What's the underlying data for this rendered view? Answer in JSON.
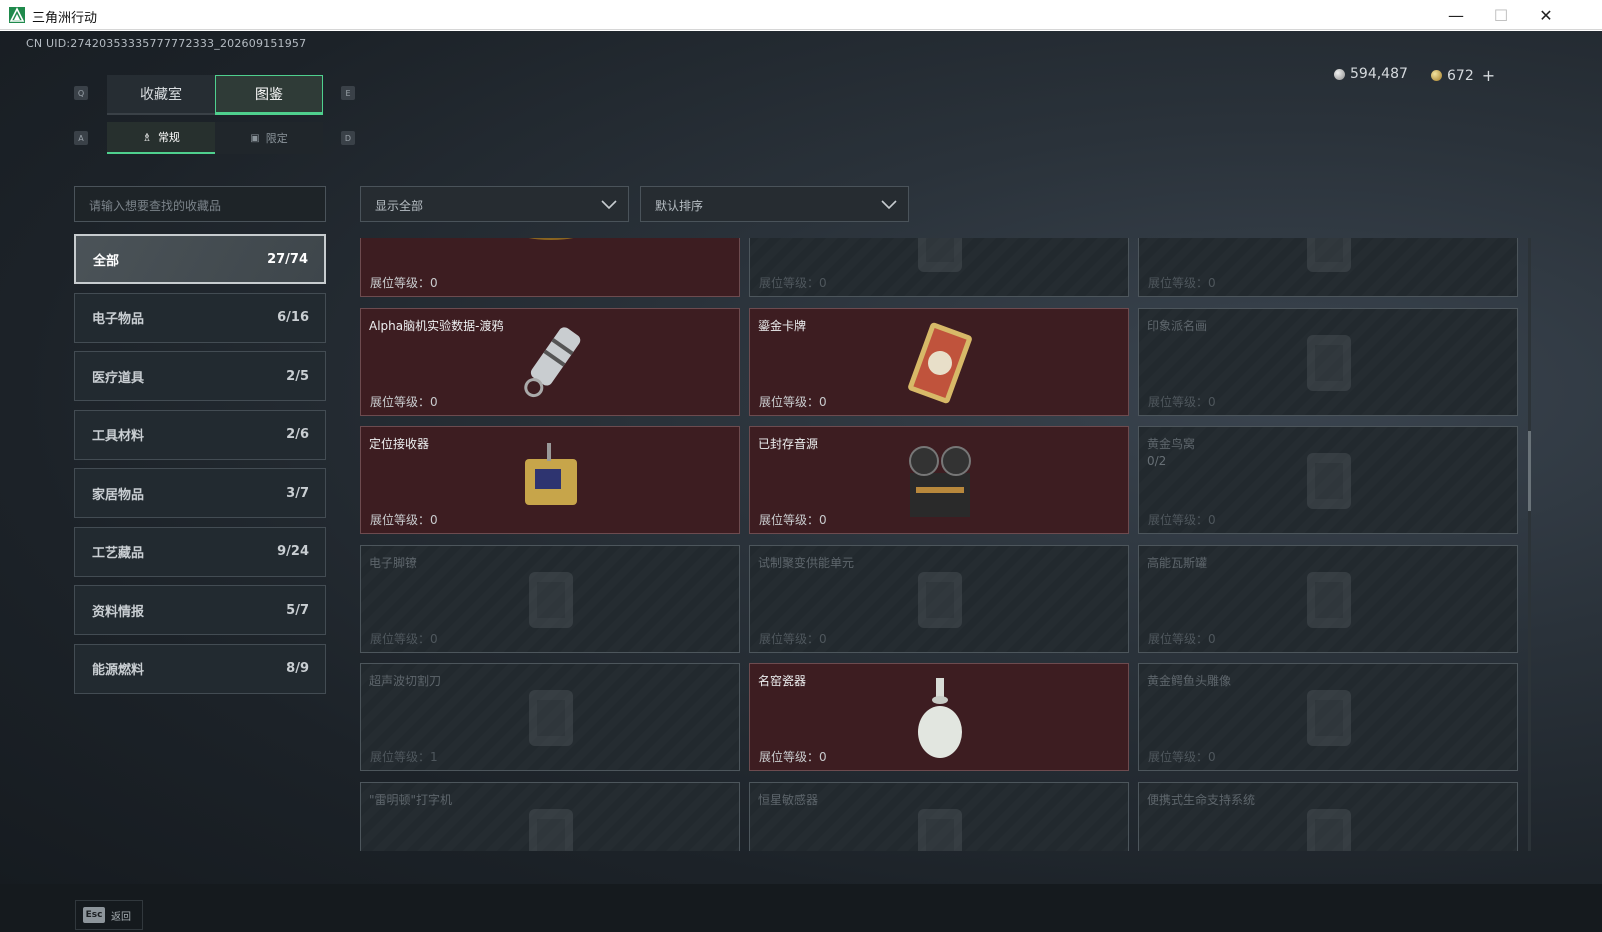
{
  "window": {
    "title": "三角洲行动",
    "minimize": "—",
    "maximize": "☐",
    "close": "✕"
  },
  "header": {
    "uid": "CN UID:27420353335777772333_202609151957",
    "currency": [
      {
        "icon": "silver-coin-icon",
        "value": "594,487"
      },
      {
        "icon": "gold-coin-icon",
        "value": "672",
        "add": "+"
      }
    ]
  },
  "tabs": {
    "key_prev": "Q",
    "key_next": "E",
    "items": [
      {
        "label": "收藏室",
        "active": false
      },
      {
        "label": "图鉴",
        "active": true
      }
    ]
  },
  "subtabs": {
    "key_prev": "A",
    "key_next": "D",
    "items": [
      {
        "label": "常规",
        "icon": "figure-icon",
        "active": true
      },
      {
        "label": "限定",
        "icon": "image-icon",
        "active": false
      }
    ]
  },
  "filters": {
    "search_placeholder": "请输入想要查找的收藏品",
    "display_filter": "显示全部",
    "sort": "默认排序"
  },
  "categories": [
    {
      "label": "全部",
      "count": "27/74",
      "active": true
    },
    {
      "label": "电子物品",
      "count": "6/16"
    },
    {
      "label": "医疗道具",
      "count": "2/5"
    },
    {
      "label": "工具材料",
      "count": "2/6"
    },
    {
      "label": "家居物品",
      "count": "3/7"
    },
    {
      "label": "工艺藏品",
      "count": "9/24"
    },
    {
      "label": "资料情报",
      "count": "5/7"
    },
    {
      "label": "能源燃料",
      "count": "8/9"
    }
  ],
  "items": [
    {
      "name": "",
      "level": "展位等级：0",
      "owned": true,
      "icon": "caviar-tin-icon"
    },
    {
      "name": "",
      "level": "展位等级：0",
      "owned": false,
      "icon": "device-icon"
    },
    {
      "name": "",
      "level": "展位等级：0",
      "owned": false,
      "icon": "crate-icon"
    },
    {
      "name": "Alpha脑机实验数据-渡鸦",
      "level": "展位等级：0",
      "owned": true,
      "icon": "data-drive-icon"
    },
    {
      "name": "鎏金卡牌",
      "level": "展位等级：0",
      "owned": true,
      "icon": "gilded-card-icon"
    },
    {
      "name": "印象派名画",
      "level": "展位等级：0",
      "owned": false,
      "icon": "painting-icon"
    },
    {
      "name": "定位接收器",
      "level": "展位等级：0",
      "owned": true,
      "icon": "receiver-icon"
    },
    {
      "name": "已封存音源",
      "level": "展位等级：0",
      "owned": true,
      "icon": "reel-recorder-icon"
    },
    {
      "name": "黄金鸟窝",
      "level": "展位等级：0",
      "owned": false,
      "icon": "golden-nest-icon",
      "extra": "0/2"
    },
    {
      "name": "电子脚镣",
      "level": "展位等级：0",
      "owned": false,
      "icon": "ankle-monitor-icon"
    },
    {
      "name": "试制聚变供能单元",
      "level": "展位等级：0",
      "owned": false,
      "icon": "fusion-unit-icon"
    },
    {
      "name": "高能瓦斯罐",
      "level": "展位等级：0",
      "owned": false,
      "icon": "gas-canister-icon"
    },
    {
      "name": "超声波切割刀",
      "level": "展位等级：1",
      "owned": false,
      "icon": "ultrasonic-knife-icon"
    },
    {
      "name": "名窑瓷器",
      "level": "展位等级：0",
      "owned": true,
      "icon": "porcelain-vase-icon"
    },
    {
      "name": "黄金鳄鱼头雕像",
      "level": "展位等级：0",
      "owned": false,
      "icon": "crocodile-statue-icon"
    },
    {
      "name": "\"雷明顿\"打字机",
      "level": "",
      "owned": false,
      "icon": "typewriter-icon"
    },
    {
      "name": "恒星敏感器",
      "level": "",
      "owned": false,
      "icon": "star-sensor-icon"
    },
    {
      "name": "便携式生命支持系统",
      "level": "",
      "owned": false,
      "icon": "life-support-icon"
    }
  ],
  "footer": {
    "esc_key": "Esc",
    "esc_label": "返回"
  },
  "colors": {
    "accent": "#4fd08e",
    "owned_card": "#3d1d21",
    "locked_card": "#22292e"
  }
}
